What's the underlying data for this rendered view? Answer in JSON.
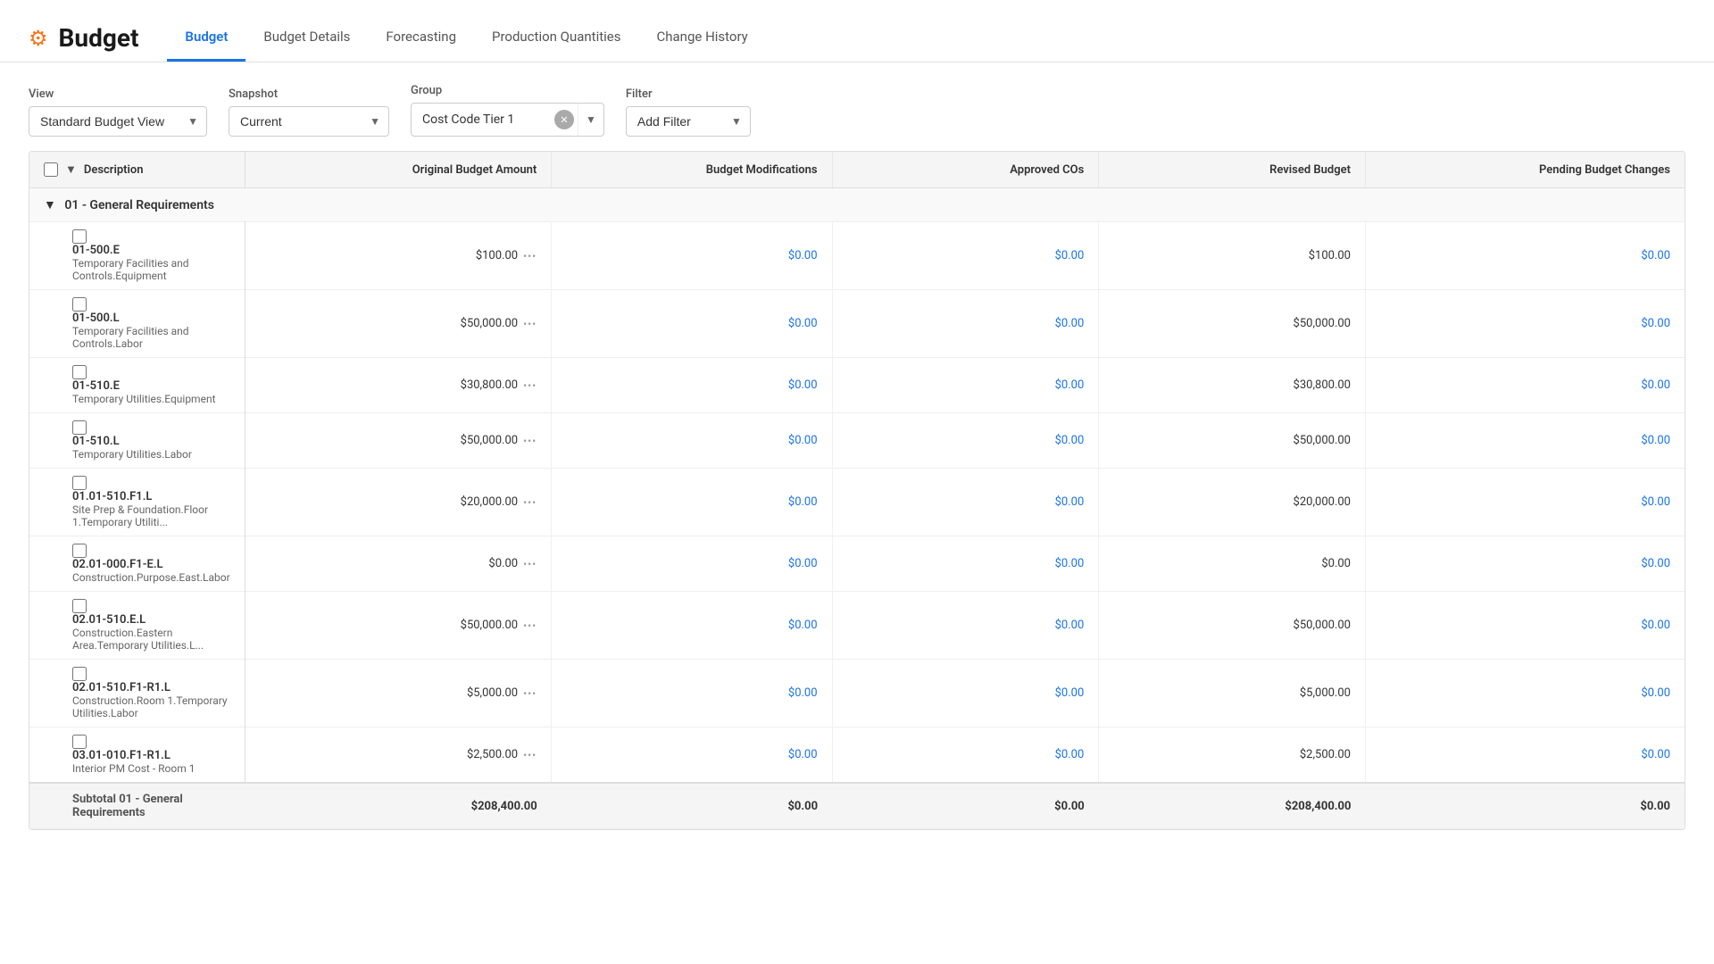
{
  "header": {
    "icon": "⚙",
    "title": "Budget",
    "tabs": [
      {
        "id": "budget",
        "label": "Budget",
        "active": true
      },
      {
        "id": "budget-details",
        "label": "Budget Details",
        "active": false
      },
      {
        "id": "forecasting",
        "label": "Forecasting",
        "active": false
      },
      {
        "id": "production-quantities",
        "label": "Production Quantities",
        "active": false
      },
      {
        "id": "change-history",
        "label": "Change History",
        "active": false
      }
    ]
  },
  "controls": {
    "view_label": "View",
    "view_value": "Standard Budget View",
    "snapshot_label": "Snapshot",
    "snapshot_value": "Current",
    "group_label": "Group",
    "group_value": "Cost Code Tier 1",
    "filter_label": "Filter",
    "filter_value": "Add Filter"
  },
  "table": {
    "columns": [
      {
        "id": "description",
        "label": "Description"
      },
      {
        "id": "original-budget-amount",
        "label": "Original Budget Amount"
      },
      {
        "id": "budget-modifications",
        "label": "Budget Modifications"
      },
      {
        "id": "approved-cos",
        "label": "Approved COs"
      },
      {
        "id": "revised-budget",
        "label": "Revised Budget"
      },
      {
        "id": "pending-budget-changes",
        "label": "Pending Budget Changes"
      }
    ],
    "groups": [
      {
        "id": "general-requirements",
        "label": "01 - General Requirements",
        "rows": [
          {
            "code": "01-500.E",
            "name": "Temporary Facilities and Controls.Equipment",
            "original_budget": "$100.00",
            "budget_mods": "$0.00",
            "approved_cos": "$0.00",
            "revised_budget": "$100.00",
            "pending_changes": "$0.00"
          },
          {
            "code": "01-500.L",
            "name": "Temporary Facilities and Controls.Labor",
            "original_budget": "$50,000.00",
            "budget_mods": "$0.00",
            "approved_cos": "$0.00",
            "revised_budget": "$50,000.00",
            "pending_changes": "$0.00"
          },
          {
            "code": "01-510.E",
            "name": "Temporary Utilities.Equipment",
            "original_budget": "$30,800.00",
            "budget_mods": "$0.00",
            "approved_cos": "$0.00",
            "revised_budget": "$30,800.00",
            "pending_changes": "$0.00"
          },
          {
            "code": "01-510.L",
            "name": "Temporary Utilities.Labor",
            "original_budget": "$50,000.00",
            "budget_mods": "$0.00",
            "approved_cos": "$0.00",
            "revised_budget": "$50,000.00",
            "pending_changes": "$0.00"
          },
          {
            "code": "01.01-510.F1.L",
            "name": "Site Prep & Foundation.Floor 1.Temporary Utiliti...",
            "original_budget": "$20,000.00",
            "budget_mods": "$0.00",
            "approved_cos": "$0.00",
            "revised_budget": "$20,000.00",
            "pending_changes": "$0.00"
          },
          {
            "code": "02.01-000.F1-E.L",
            "name": "Construction.Purpose.East.Labor",
            "original_budget": "$0.00",
            "budget_mods": "$0.00",
            "approved_cos": "$0.00",
            "revised_budget": "$0.00",
            "pending_changes": "$0.00"
          },
          {
            "code": "02.01-510.E.L",
            "name": "Construction.Eastern Area.Temporary Utilities.L...",
            "original_budget": "$50,000.00",
            "budget_mods": "$0.00",
            "approved_cos": "$0.00",
            "revised_budget": "$50,000.00",
            "pending_changes": "$0.00"
          },
          {
            "code": "02.01-510.F1-R1.L",
            "name": "Construction.Room 1.Temporary Utilities.Labor",
            "original_budget": "$5,000.00",
            "budget_mods": "$0.00",
            "approved_cos": "$0.00",
            "revised_budget": "$5,000.00",
            "pending_changes": "$0.00"
          },
          {
            "code": "03.01-010.F1-R1.L",
            "name": "Interior PM Cost - Room 1",
            "original_budget": "$2,500.00",
            "budget_mods": "$0.00",
            "approved_cos": "$0.00",
            "revised_budget": "$2,500.00",
            "pending_changes": "$0.00"
          }
        ],
        "subtotal": {
          "label": "Subtotal 01 - General Requirements",
          "original_budget": "$208,400.00",
          "budget_mods": "$0.00",
          "approved_cos": "$0.00",
          "revised_budget": "$208,400.00",
          "pending_changes": "$0.00"
        }
      }
    ]
  },
  "colors": {
    "accent_blue": "#1a73e8",
    "orange": "#f97316",
    "link_blue": "#1a73e8"
  }
}
